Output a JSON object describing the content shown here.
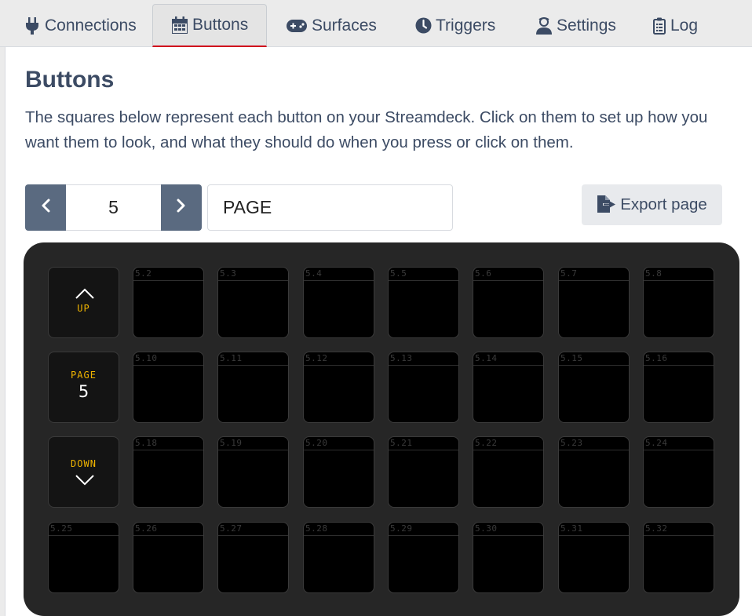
{
  "tabs": [
    {
      "label": "Connections",
      "icon": "plug-icon"
    },
    {
      "label": "Buttons",
      "icon": "calendar-grid-icon",
      "active": true
    },
    {
      "label": "Surfaces",
      "icon": "gamepad-icon"
    },
    {
      "label": "Triggers",
      "icon": "clock-icon"
    },
    {
      "label": "Settings",
      "icon": "user-cog-icon"
    },
    {
      "label": "Log",
      "icon": "clipboard-list-icon"
    }
  ],
  "page": {
    "title": "Buttons",
    "description": "The squares below represent each button on your Streamdeck. Click on them to set up how you want them to look, and what they should do when you press or click on them.",
    "page_number": "5",
    "page_name": "PAGE",
    "export_label": "Export page"
  },
  "nav_keys": {
    "up_label": "UP",
    "page_label": "PAGE",
    "page_value": "5",
    "down_label": "DOWN"
  },
  "key_labels": [
    "5.2",
    "5.3",
    "5.4",
    "5.5",
    "5.6",
    "5.7",
    "5.8",
    "5.10",
    "5.11",
    "5.12",
    "5.13",
    "5.14",
    "5.15",
    "5.16",
    "5.18",
    "5.19",
    "5.20",
    "5.21",
    "5.22",
    "5.23",
    "5.24",
    "5.25",
    "5.26",
    "5.27",
    "5.28",
    "5.29",
    "5.30",
    "5.31",
    "5.32"
  ],
  "colors": {
    "accent_tab_underline": "#d0021b",
    "nav_text": "#f0b400",
    "grid_bg": "#262626",
    "page_button_bg": "#5a6a80"
  }
}
